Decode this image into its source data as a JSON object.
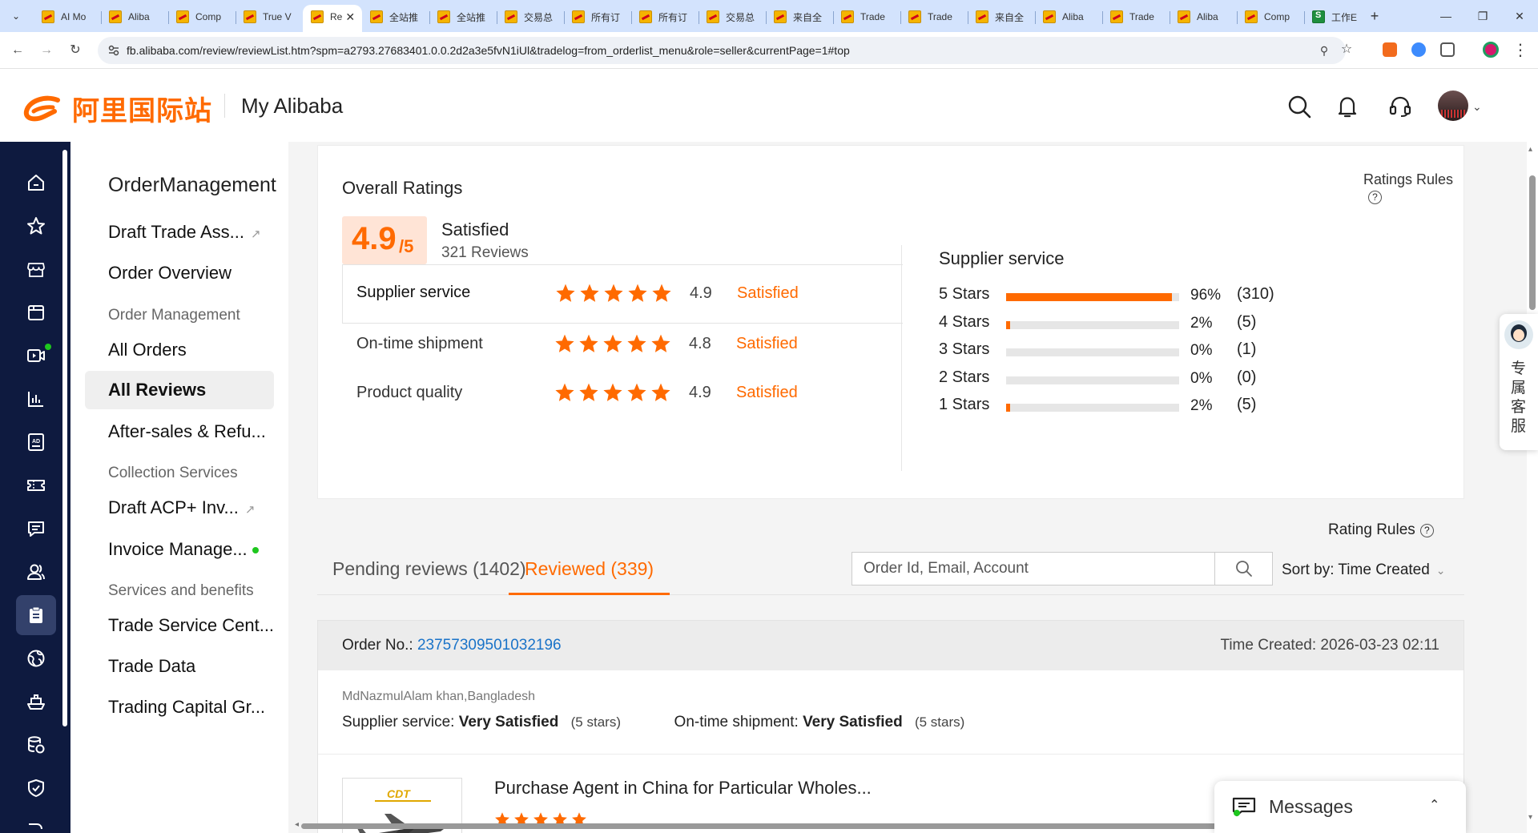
{
  "browser": {
    "tabs": [
      {
        "title": "AI Mo",
        "icon": "alibaba-favicon"
      },
      {
        "title": "Aliba",
        "icon": "alibaba-favicon"
      },
      {
        "title": "Comp",
        "icon": "alibaba-favicon"
      },
      {
        "title": "True V",
        "icon": "alibaba-favicon"
      },
      {
        "title": "Re",
        "icon": "alibaba-favicon",
        "active": true
      },
      {
        "title": "全站推",
        "icon": "alibaba-favicon"
      },
      {
        "title": "全站推",
        "icon": "alibaba-favicon"
      },
      {
        "title": "交易总",
        "icon": "alibaba-favicon"
      },
      {
        "title": "所有订",
        "icon": "alibaba-favicon"
      },
      {
        "title": "所有订",
        "icon": "alibaba-favicon"
      },
      {
        "title": "交易总",
        "icon": "alibaba-favicon"
      },
      {
        "title": "来自全",
        "icon": "alibaba-favicon"
      },
      {
        "title": "Trade",
        "icon": "alibaba-favicon"
      },
      {
        "title": "Trade",
        "icon": "alibaba-favicon"
      },
      {
        "title": "来自全",
        "icon": "alibaba-favicon"
      },
      {
        "title": "Aliba",
        "icon": "alibaba-favicon"
      },
      {
        "title": "Trade",
        "icon": "alibaba-favicon"
      },
      {
        "title": "Aliba",
        "icon": "alibaba-favicon"
      },
      {
        "title": "Comp",
        "icon": "alibaba-favicon"
      },
      {
        "title": "工作E",
        "icon": "sheets-favicon"
      }
    ],
    "url": "fb.alibaba.com/review/reviewList.htm?spm=a2793.27683401.0.0.2d2a3e5fvN1iUl&tradelog=from_orderlist_menu&role=seller&currentPage=1#top"
  },
  "header": {
    "logo_text": "阿里国际站",
    "title": "My Alibaba"
  },
  "sidemenu": {
    "title": "OrderManagement",
    "items": [
      {
        "label": "Draft Trade Ass...",
        "external": true
      },
      {
        "label": "Order Overview"
      }
    ],
    "group_order_management": "Order Management",
    "all_orders": "All Orders",
    "all_reviews": "All Reviews",
    "after_sales": "After-sales & Refu...",
    "group_collection": "Collection Services",
    "draft_acp": "Draft ACP+ Inv...",
    "invoice": "Invoice Manage...",
    "group_services": "Services and benefits",
    "trade_service": "Trade Service Cent...",
    "trade_data": "Trade Data",
    "trading_capital": "Trading Capital Gr..."
  },
  "ratings": {
    "title": "Overall Ratings",
    "rules_label": "Ratings Rules",
    "score": "4.9",
    "score_max": "/5",
    "status": "Satisfied",
    "review_count": "321 Reviews",
    "metrics": [
      {
        "label": "Supplier service",
        "score": "4.9",
        "status": "Satisfied",
        "stars": 5
      },
      {
        "label": "On-time shipment",
        "score": "4.8",
        "status": "Satisfied",
        "stars": 5
      },
      {
        "label": "Product quality",
        "score": "4.9",
        "status": "Satisfied",
        "stars": 5
      }
    ],
    "breakdown_title": "Supplier service",
    "distribution": [
      {
        "label": "5  Stars",
        "percent": 96,
        "pct_text": "96%",
        "count": "(310)"
      },
      {
        "label": "4  Stars",
        "percent": 2,
        "pct_text": "2%",
        "count": "(5)"
      },
      {
        "label": "3  Stars",
        "percent": 0,
        "pct_text": "0%",
        "count": "(1)"
      },
      {
        "label": "2  Stars",
        "percent": 0,
        "pct_text": "0%",
        "count": "(0)"
      },
      {
        "label": "1  Stars",
        "percent": 2,
        "pct_text": "2%",
        "count": "(5)"
      }
    ]
  },
  "reviews": {
    "rating_rules_label": "Rating Rules",
    "tab_pending": "Pending reviews (1402)",
    "tab_reviewed": "Reviewed (339)",
    "search_placeholder": "Order Id, Email, Account",
    "sort_label": "Sort by: Time Created"
  },
  "order": {
    "order_no_label": "Order No.:",
    "order_no": "23757309501032196",
    "time_created": "Time Created: 2026-03-23 02:11",
    "buyer": "MdNazmulAlam khan,Bangladesh",
    "supplier_label": "Supplier service:",
    "supplier_value": "Very Satisfied",
    "supplier_stars": "(5 stars)",
    "shipment_label": "On-time shipment:",
    "shipment_value": "Very Satisfied",
    "shipment_stars": "(5 stars)",
    "product_title": "Purchase Agent in China for Particular Wholes...",
    "thumb_logo": "CDT"
  },
  "widgets": {
    "customer_service": "专属客服",
    "messages": "Messages"
  },
  "colors": {
    "accent": "#ff6a00",
    "rail_bg": "#0e1a3f",
    "link": "#1a73c8"
  }
}
